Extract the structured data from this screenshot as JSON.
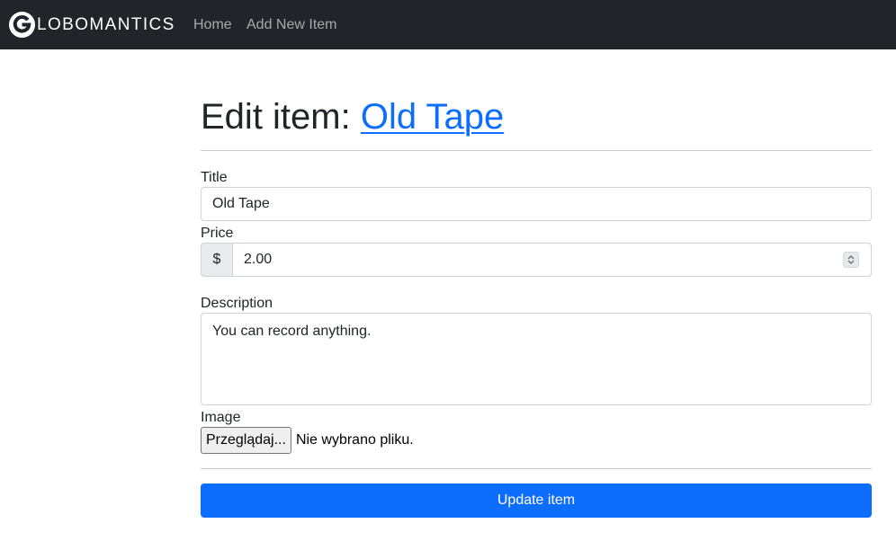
{
  "navbar": {
    "brand_text": "LOBOMANTICS",
    "logo_icon": "globomantics-g-logo-icon",
    "links": [
      {
        "label": "Home"
      },
      {
        "label": "Add New Item"
      }
    ]
  },
  "page": {
    "heading_prefix": "Edit item: ",
    "heading_link": "Old Tape"
  },
  "form": {
    "title_label": "Title",
    "title_value": "Old Tape",
    "price_label": "Price",
    "price_prefix": "$",
    "price_value": "2.00",
    "price_spinner_icon": "number-spinner-icon",
    "description_label": "Description",
    "description_value": "You can record anything.",
    "image_label": "Image",
    "file_button_label": "Przeglądaj...",
    "file_status": "Nie wybrano pliku.",
    "submit_label": "Update item"
  },
  "colors": {
    "navbar_bg": "#212529",
    "link": "#0d6efd",
    "button_primary": "#0d6efd"
  }
}
